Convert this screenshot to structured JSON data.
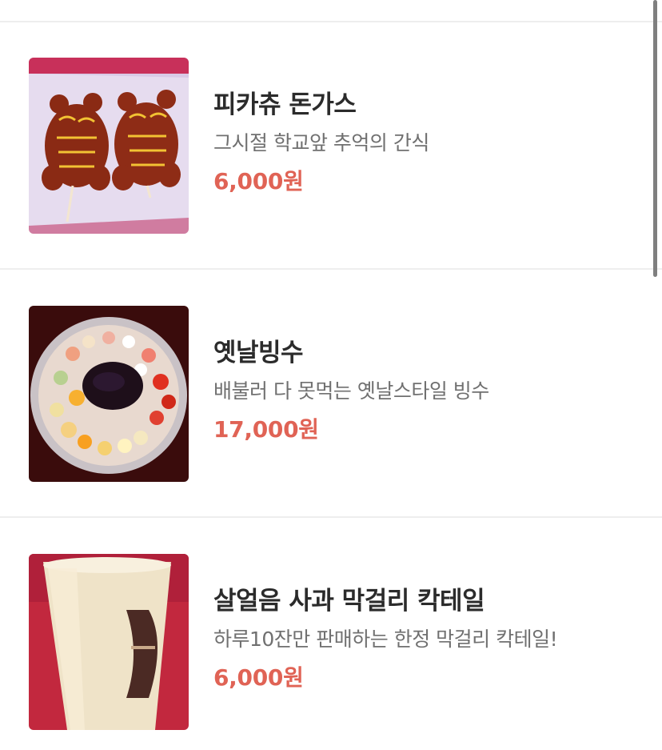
{
  "menu": {
    "items": [
      {
        "name": "피카츄 돈가스",
        "description": "그시절 학교앞 추억의 간식",
        "price": "6,000원",
        "photo": "pikachu-donkatsu-photo"
      },
      {
        "name": "옛날빙수",
        "description": "배불러 다 못먹는 옛날스타일 빙수",
        "price": "17,000원",
        "photo": "bingsu-photo"
      },
      {
        "name": "살얼음 사과 막걸리 칵테일",
        "description": "하루10잔만 판매하는 한정 막걸리 칵테일!",
        "price": "6,000원",
        "photo": "makgeolli-cocktail-photo"
      }
    ]
  },
  "colors": {
    "price": "#e06355",
    "name": "#2b2b2b",
    "description": "#707070",
    "divider": "#eeeeee"
  }
}
